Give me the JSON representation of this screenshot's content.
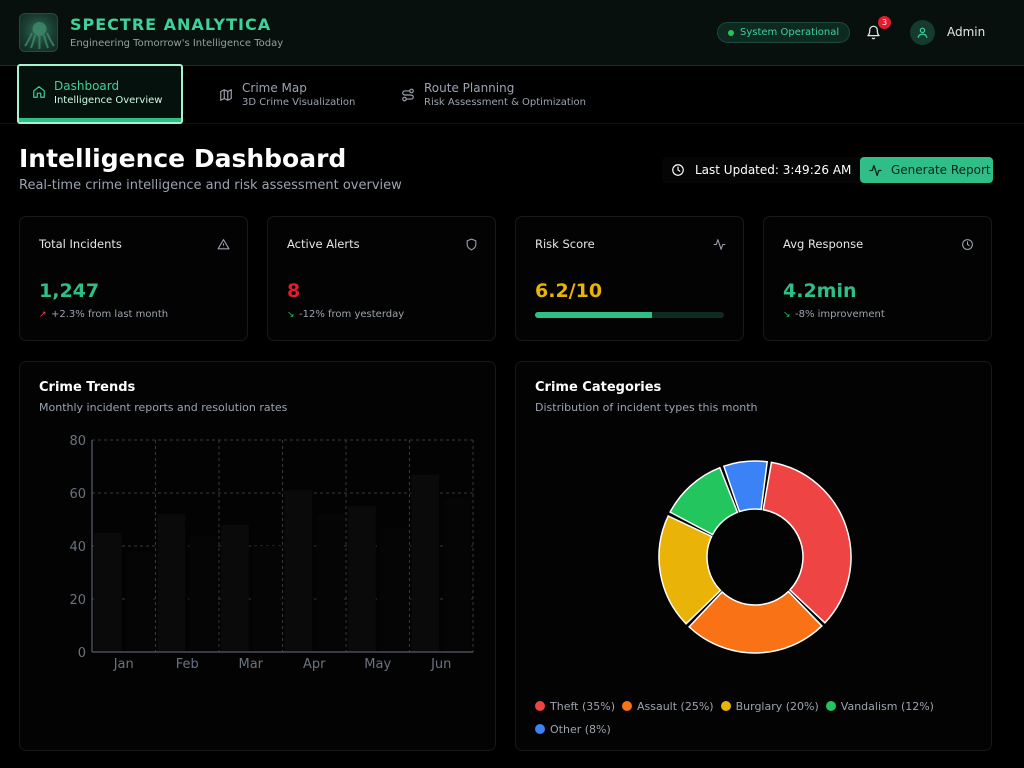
{
  "header": {
    "brand": "SPECTRE ANALYTICA",
    "tagline": "Engineering Tomorrow's Intelligence Today",
    "status": "System Operational",
    "notification_count": "3",
    "user": "Admin"
  },
  "tabs": [
    {
      "title": "Dashboard",
      "subtitle": "Intelligence Overview",
      "icon": "home-icon",
      "active": true
    },
    {
      "title": "Crime Map",
      "subtitle": "3D Crime Visualization",
      "icon": "map-icon",
      "active": false
    },
    {
      "title": "Route Planning",
      "subtitle": "Risk Assessment & Optimization",
      "icon": "route-icon",
      "active": false
    }
  ],
  "page": {
    "title": "Intelligence Dashboard",
    "subtitle": "Real-time crime intelligence and risk assessment overview",
    "last_updated": "Last Updated: 3:49:26 AM",
    "generate_report": "Generate Report"
  },
  "stats": [
    {
      "label": "Total Incidents",
      "value": "1,247",
      "change": "+2.3% from last month",
      "icon": "alert-triangle-icon",
      "color": "#2fbf86",
      "trend": "up"
    },
    {
      "label": "Active Alerts",
      "value": "8",
      "change": "-12% from yesterday",
      "icon": "shield-icon",
      "color": "#e11d2e",
      "trend": "down"
    },
    {
      "label": "Risk Score",
      "value": "6.2/10",
      "progress": 0.62,
      "icon": "activity-icon",
      "color": "#eab308"
    },
    {
      "label": "Avg Response",
      "value": "4.2min",
      "change": "-8% improvement",
      "icon": "clock-icon",
      "color": "#2fbf86",
      "trend": "down"
    }
  ],
  "trends_panel": {
    "title": "Crime Trends",
    "subtitle": "Monthly incident reports and resolution rates"
  },
  "categories_panel": {
    "title": "Crime Categories",
    "subtitle": "Distribution of incident types this month"
  },
  "colors": {
    "accent": "#2fbf86",
    "danger": "#e11d2e",
    "warning": "#eab308"
  },
  "chart_data": [
    {
      "type": "bar",
      "categories": [
        "Jan",
        "Feb",
        "Mar",
        "Apr",
        "May",
        "Jun"
      ],
      "series": [
        {
          "values": [
            45,
            52,
            48,
            61,
            55,
            67
          ],
          "color": "#0a0a0a"
        },
        {
          "values": [
            38,
            44,
            40,
            52,
            47,
            58
          ],
          "color": "#050505"
        }
      ],
      "ylim": [
        0,
        80
      ],
      "yticks": [
        0,
        20,
        40,
        60,
        80
      ],
      "grid": true
    },
    {
      "type": "pie",
      "labels": [
        "Theft",
        "Assault",
        "Burglary",
        "Vandalism",
        "Other"
      ],
      "values": [
        35,
        25,
        20,
        12,
        8
      ],
      "legend_labels": [
        "Theft (35%)",
        "Assault (25%)",
        "Burglary (20%)",
        "Vandalism (12%)",
        "Other (8%)"
      ],
      "colors": [
        "#ef4444",
        "#f97316",
        "#eab308",
        "#22c55e",
        "#3b82f6"
      ],
      "donut": true
    }
  ]
}
